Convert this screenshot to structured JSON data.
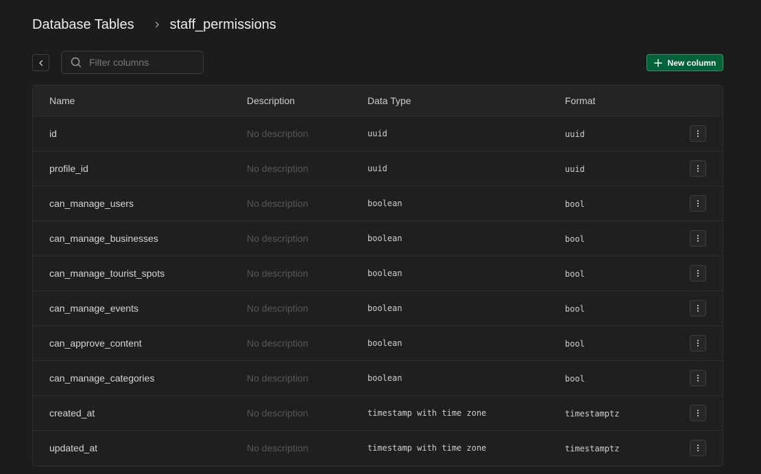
{
  "breadcrumb": {
    "root": "Database Tables",
    "current": "staff_permissions",
    "separator_icon": "chevron-right-icon"
  },
  "toolbar": {
    "back_icon": "chevron-left-icon",
    "search_placeholder": "Filter columns",
    "search_value": "",
    "new_column_label": "New column",
    "new_column_color": "#006239"
  },
  "table": {
    "headers": {
      "name": "Name",
      "description": "Description",
      "data_type": "Data Type",
      "format": "Format"
    },
    "rows": [
      {
        "name": "id",
        "description": "No description",
        "data_type": "uuid",
        "format": "uuid"
      },
      {
        "name": "profile_id",
        "description": "No description",
        "data_type": "uuid",
        "format": "uuid"
      },
      {
        "name": "can_manage_users",
        "description": "No description",
        "data_type": "boolean",
        "format": "bool"
      },
      {
        "name": "can_manage_businesses",
        "description": "No description",
        "data_type": "boolean",
        "format": "bool"
      },
      {
        "name": "can_manage_tourist_spots",
        "description": "No description",
        "data_type": "boolean",
        "format": "bool"
      },
      {
        "name": "can_manage_events",
        "description": "No description",
        "data_type": "boolean",
        "format": "bool"
      },
      {
        "name": "can_approve_content",
        "description": "No description",
        "data_type": "boolean",
        "format": "bool"
      },
      {
        "name": "can_manage_categories",
        "description": "No description",
        "data_type": "boolean",
        "format": "bool"
      },
      {
        "name": "created_at",
        "description": "No description",
        "data_type": "timestamp with time zone",
        "format": "timestamptz"
      },
      {
        "name": "updated_at",
        "description": "No description",
        "data_type": "timestamp with time zone",
        "format": "timestamptz"
      }
    ],
    "row_action_icon": "more-vertical-icon"
  }
}
